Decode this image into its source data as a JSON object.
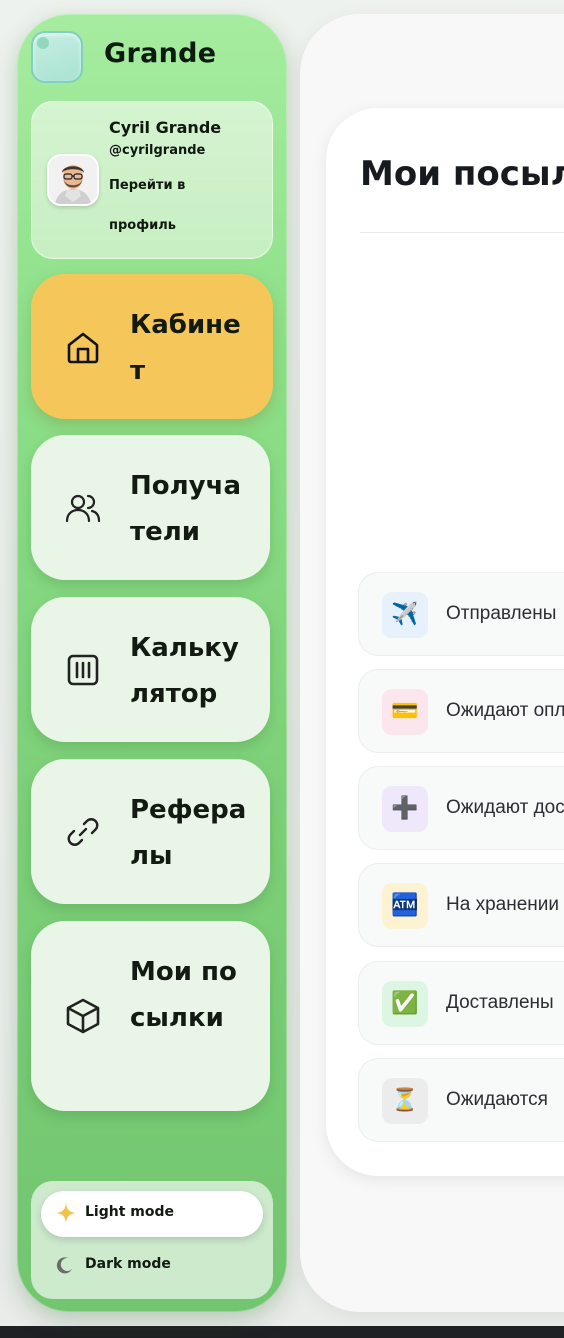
{
  "brand": {
    "name": "Grande"
  },
  "profile": {
    "name": "Cyril Grande",
    "handle": "@cyrilgrande",
    "link_line1": "Перейти в",
    "link_line2": "профиль"
  },
  "nav": [
    {
      "label": "Кабинет",
      "icon": "home-icon",
      "active": true
    },
    {
      "label": "Получатели",
      "icon": "users-icon",
      "active": false
    },
    {
      "label": "Калькулятор",
      "icon": "calculator-icon",
      "active": false
    },
    {
      "label": "Рефералы",
      "icon": "link-icon",
      "active": false
    },
    {
      "label": "Мои посылки",
      "icon": "box-icon",
      "active": false
    }
  ],
  "theme": {
    "light_label": "Light mode",
    "dark_label": "Dark mode",
    "selected": "light"
  },
  "main": {
    "title": "Мои посылки",
    "statuses": [
      {
        "label": "Отправлены",
        "icon": "airplane-icon",
        "glyph": "✈️",
        "bg": "#e6f1fb"
      },
      {
        "label": "Ожидают оплаты",
        "icon": "card-icon",
        "glyph": "💳",
        "bg": "#fbe6ee"
      },
      {
        "label": "Ожидают доставки",
        "icon": "plus-icon",
        "glyph": "➕",
        "bg": "#efe8fb"
      },
      {
        "label": "На хранении",
        "icon": "atm-icon",
        "glyph": "🏧",
        "bg": "#fdf3d2"
      },
      {
        "label": "Доставлены",
        "icon": "check-icon",
        "glyph": "✅",
        "bg": "#ddf5e3"
      },
      {
        "label": "Ожидаются",
        "icon": "hourglass-icon",
        "glyph": "⏳",
        "bg": "#ececec"
      }
    ]
  },
  "colors": {
    "accent": "#f5c75b",
    "sidebar": "#8ee089",
    "text": "#171a1f"
  }
}
